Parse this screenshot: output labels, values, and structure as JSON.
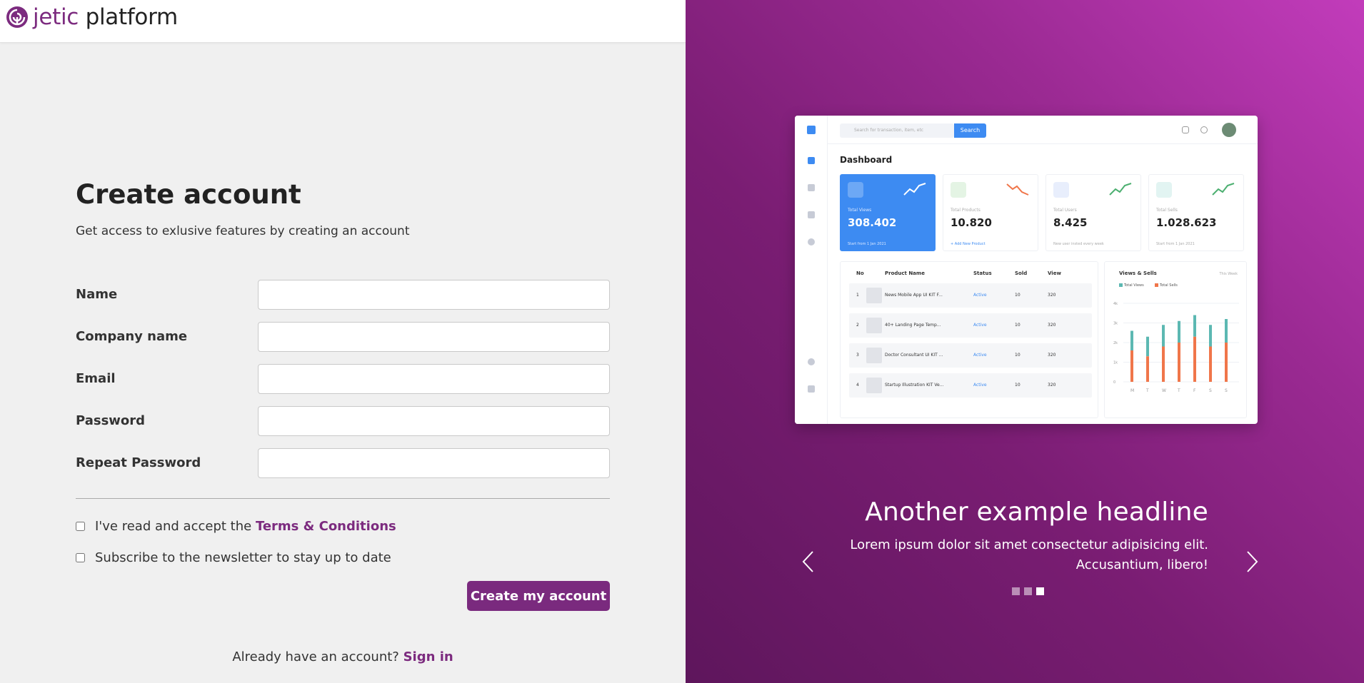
{
  "brand": {
    "name_part1": "jetic",
    "name_part2": "platform",
    "logo_icon": "jetic-logo-icon"
  },
  "form": {
    "title": "Create account",
    "subtitle": "Get access to exlusive features by creating an account",
    "fields": [
      {
        "label": "Name",
        "value": ""
      },
      {
        "label": "Company name",
        "value": ""
      },
      {
        "label": "Email",
        "value": ""
      },
      {
        "label": "Password",
        "value": ""
      },
      {
        "label": "Repeat Password",
        "value": ""
      }
    ],
    "terms_prefix": "I've read and accept the",
    "terms_link": "Terms & Conditions",
    "terms_checked": false,
    "newsletter_label": "Subscribe to the newsletter to stay up to date",
    "newsletter_checked": false,
    "submit_label": "Create my account",
    "signin_prefix": "Already have an account?",
    "signin_link": "Sign in",
    "accent_color": "#7a2a7e"
  },
  "carousel": {
    "headline": "Another example headline",
    "text_line1": "Lorem ipsum dolor sit amet consectetur adipisicing elit.",
    "text_line2": "Accusantium, libero!",
    "slide_count": 3,
    "active_index": 2,
    "prev_icon": "chevron-left-icon",
    "next_icon": "chevron-right-icon",
    "preview": {
      "search_placeholder": "Search for transaction, item, etc",
      "search_button": "Search",
      "heading": "Dashboard",
      "cards": [
        {
          "label": "Total Views",
          "value": "308.402",
          "foot": "Start from 1 Jan 2021"
        },
        {
          "label": "Total Products",
          "value": "10.820",
          "foot": "+ Add New Product"
        },
        {
          "label": "Total Users",
          "value": "8.425",
          "foot": "New user insted every week"
        },
        {
          "label": "Total Sells",
          "value": "1.028.623",
          "foot": "Start from 1 Jan 2021"
        }
      ],
      "table_headers": [
        "No",
        "Product Name",
        "Status",
        "Sold",
        "View"
      ],
      "table_rows": [
        {
          "no": "1",
          "name": "News Mobile App UI KIT F...",
          "status": "Active",
          "sold": "10",
          "view": "320"
        },
        {
          "no": "2",
          "name": "40+ Landing Page Temp...",
          "status": "Active",
          "sold": "10",
          "view": "320"
        },
        {
          "no": "3",
          "name": "Doctor Consultant UI KIT ...",
          "status": "Active",
          "sold": "10",
          "view": "320"
        },
        {
          "no": "4",
          "name": "Startup Illustration KIT Ve...",
          "status": "Active",
          "sold": "10",
          "view": "320"
        }
      ],
      "chart_title": "Views & Sells",
      "chart_period": "This Week",
      "legend": [
        "Total Views",
        "Total Sells"
      ],
      "y_ticks": [
        "4k",
        "3k",
        "2k",
        "1k",
        "0"
      ],
      "days": [
        "M",
        "T",
        "W",
        "T",
        "F",
        "S",
        "S"
      ],
      "views": [
        2.6,
        2.3,
        2.9,
        3.1,
        3.4,
        2.9,
        3.2
      ],
      "sells": [
        1.6,
        1.3,
        1.8,
        2.0,
        2.3,
        1.8,
        2.0
      ]
    }
  }
}
